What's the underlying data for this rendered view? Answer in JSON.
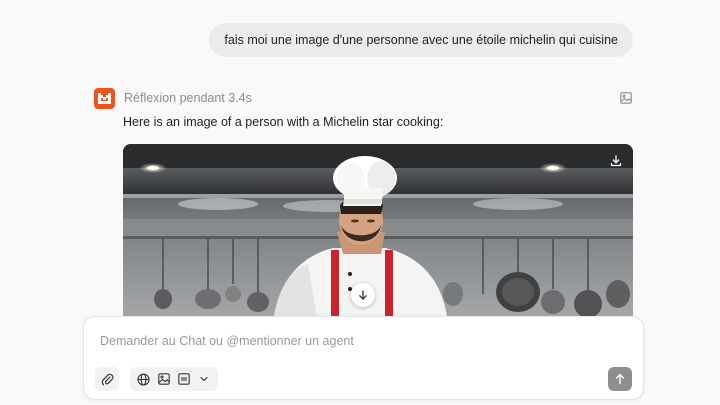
{
  "conversation": {
    "user_message": "fais moi une image d'une personne avec une étoile michelin qui cuisine",
    "assistant": {
      "thinking_label": "Réflexion pendant 3.4s",
      "answer_text": "Here is an image of a person with a Michelin star cooking:",
      "image_alt": "Chef in white toque and red apron cooking in a professional kitchen"
    }
  },
  "composer": {
    "placeholder": "Demander au Chat ou @mentionner un agent",
    "value": ""
  },
  "icons": {
    "logo": "mistral-logo",
    "image_toggle": "image-icon",
    "download": "download-icon",
    "scroll_down": "arrow-down-icon",
    "attach": "paperclip-icon",
    "web": "globe-icon",
    "image_gen": "image-icon",
    "canvas": "canvas-icon",
    "more": "chevron-down-icon",
    "send": "arrow-up-icon"
  },
  "colors": {
    "accent": "#f0541c",
    "send_disabled": "#8e8e8e",
    "apron": "#c8252c"
  }
}
